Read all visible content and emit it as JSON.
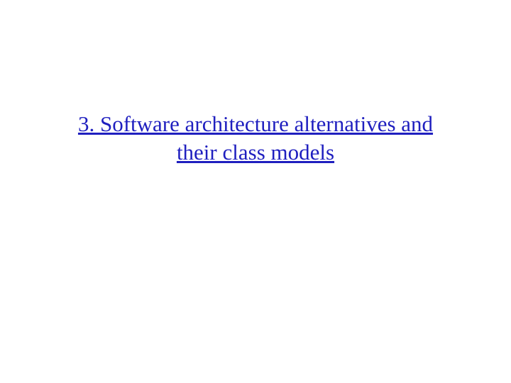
{
  "slide": {
    "title": "3. Software architecture alternatives and their class models",
    "title_color": "#1f1fbf"
  }
}
